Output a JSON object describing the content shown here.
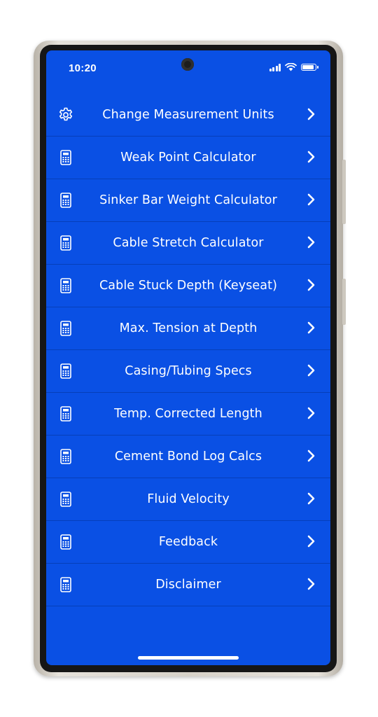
{
  "status_bar": {
    "time": "10:20",
    "icons": [
      "camera-icon",
      "signal-icon",
      "wifi-icon",
      "battery-icon"
    ]
  },
  "theme": {
    "background": "#0a50e4",
    "divider": "#063fb9",
    "text": "#ffffff"
  },
  "menu": {
    "items": [
      {
        "label": "Change Measurement Units",
        "icon": "gear-icon"
      },
      {
        "label": "Weak Point Calculator",
        "icon": "calculator-icon"
      },
      {
        "label": "Sinker Bar Weight Calculator",
        "icon": "calculator-icon"
      },
      {
        "label": "Cable Stretch Calculator",
        "icon": "calculator-icon"
      },
      {
        "label": "Cable Stuck Depth (Keyseat)",
        "icon": "calculator-icon"
      },
      {
        "label": "Max. Tension at Depth",
        "icon": "calculator-icon"
      },
      {
        "label": "Casing/Tubing Specs",
        "icon": "calculator-icon"
      },
      {
        "label": "Temp. Corrected Length",
        "icon": "calculator-icon"
      },
      {
        "label": "Cement Bond Log Calcs",
        "icon": "calculator-icon"
      },
      {
        "label": "Fluid Velocity",
        "icon": "calculator-icon"
      },
      {
        "label": "Feedback",
        "icon": "calculator-icon"
      },
      {
        "label": "Disclaimer",
        "icon": "calculator-icon"
      }
    ]
  }
}
